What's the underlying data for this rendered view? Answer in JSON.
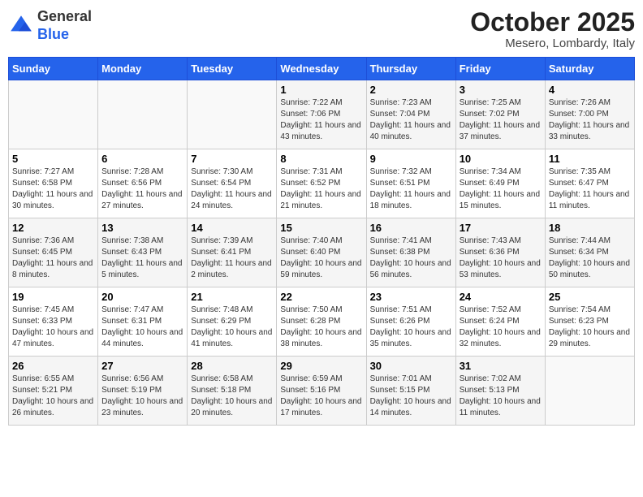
{
  "header": {
    "logo": {
      "general": "General",
      "blue": "Blue"
    },
    "title": "October 2025",
    "location": "Mesero, Lombardy, Italy"
  },
  "days_of_week": [
    "Sunday",
    "Monday",
    "Tuesday",
    "Wednesday",
    "Thursday",
    "Friday",
    "Saturday"
  ],
  "weeks": [
    [
      {
        "day": "",
        "info": ""
      },
      {
        "day": "",
        "info": ""
      },
      {
        "day": "",
        "info": ""
      },
      {
        "day": "1",
        "info": "Sunrise: 7:22 AM\nSunset: 7:06 PM\nDaylight: 11 hours and 43 minutes."
      },
      {
        "day": "2",
        "info": "Sunrise: 7:23 AM\nSunset: 7:04 PM\nDaylight: 11 hours and 40 minutes."
      },
      {
        "day": "3",
        "info": "Sunrise: 7:25 AM\nSunset: 7:02 PM\nDaylight: 11 hours and 37 minutes."
      },
      {
        "day": "4",
        "info": "Sunrise: 7:26 AM\nSunset: 7:00 PM\nDaylight: 11 hours and 33 minutes."
      }
    ],
    [
      {
        "day": "5",
        "info": "Sunrise: 7:27 AM\nSunset: 6:58 PM\nDaylight: 11 hours and 30 minutes."
      },
      {
        "day": "6",
        "info": "Sunrise: 7:28 AM\nSunset: 6:56 PM\nDaylight: 11 hours and 27 minutes."
      },
      {
        "day": "7",
        "info": "Sunrise: 7:30 AM\nSunset: 6:54 PM\nDaylight: 11 hours and 24 minutes."
      },
      {
        "day": "8",
        "info": "Sunrise: 7:31 AM\nSunset: 6:52 PM\nDaylight: 11 hours and 21 minutes."
      },
      {
        "day": "9",
        "info": "Sunrise: 7:32 AM\nSunset: 6:51 PM\nDaylight: 11 hours and 18 minutes."
      },
      {
        "day": "10",
        "info": "Sunrise: 7:34 AM\nSunset: 6:49 PM\nDaylight: 11 hours and 15 minutes."
      },
      {
        "day": "11",
        "info": "Sunrise: 7:35 AM\nSunset: 6:47 PM\nDaylight: 11 hours and 11 minutes."
      }
    ],
    [
      {
        "day": "12",
        "info": "Sunrise: 7:36 AM\nSunset: 6:45 PM\nDaylight: 11 hours and 8 minutes."
      },
      {
        "day": "13",
        "info": "Sunrise: 7:38 AM\nSunset: 6:43 PM\nDaylight: 11 hours and 5 minutes."
      },
      {
        "day": "14",
        "info": "Sunrise: 7:39 AM\nSunset: 6:41 PM\nDaylight: 11 hours and 2 minutes."
      },
      {
        "day": "15",
        "info": "Sunrise: 7:40 AM\nSunset: 6:40 PM\nDaylight: 10 hours and 59 minutes."
      },
      {
        "day": "16",
        "info": "Sunrise: 7:41 AM\nSunset: 6:38 PM\nDaylight: 10 hours and 56 minutes."
      },
      {
        "day": "17",
        "info": "Sunrise: 7:43 AM\nSunset: 6:36 PM\nDaylight: 10 hours and 53 minutes."
      },
      {
        "day": "18",
        "info": "Sunrise: 7:44 AM\nSunset: 6:34 PM\nDaylight: 10 hours and 50 minutes."
      }
    ],
    [
      {
        "day": "19",
        "info": "Sunrise: 7:45 AM\nSunset: 6:33 PM\nDaylight: 10 hours and 47 minutes."
      },
      {
        "day": "20",
        "info": "Sunrise: 7:47 AM\nSunset: 6:31 PM\nDaylight: 10 hours and 44 minutes."
      },
      {
        "day": "21",
        "info": "Sunrise: 7:48 AM\nSunset: 6:29 PM\nDaylight: 10 hours and 41 minutes."
      },
      {
        "day": "22",
        "info": "Sunrise: 7:50 AM\nSunset: 6:28 PM\nDaylight: 10 hours and 38 minutes."
      },
      {
        "day": "23",
        "info": "Sunrise: 7:51 AM\nSunset: 6:26 PM\nDaylight: 10 hours and 35 minutes."
      },
      {
        "day": "24",
        "info": "Sunrise: 7:52 AM\nSunset: 6:24 PM\nDaylight: 10 hours and 32 minutes."
      },
      {
        "day": "25",
        "info": "Sunrise: 7:54 AM\nSunset: 6:23 PM\nDaylight: 10 hours and 29 minutes."
      }
    ],
    [
      {
        "day": "26",
        "info": "Sunrise: 6:55 AM\nSunset: 5:21 PM\nDaylight: 10 hours and 26 minutes."
      },
      {
        "day": "27",
        "info": "Sunrise: 6:56 AM\nSunset: 5:19 PM\nDaylight: 10 hours and 23 minutes."
      },
      {
        "day": "28",
        "info": "Sunrise: 6:58 AM\nSunset: 5:18 PM\nDaylight: 10 hours and 20 minutes."
      },
      {
        "day": "29",
        "info": "Sunrise: 6:59 AM\nSunset: 5:16 PM\nDaylight: 10 hours and 17 minutes."
      },
      {
        "day": "30",
        "info": "Sunrise: 7:01 AM\nSunset: 5:15 PM\nDaylight: 10 hours and 14 minutes."
      },
      {
        "day": "31",
        "info": "Sunrise: 7:02 AM\nSunset: 5:13 PM\nDaylight: 10 hours and 11 minutes."
      },
      {
        "day": "",
        "info": ""
      }
    ]
  ]
}
